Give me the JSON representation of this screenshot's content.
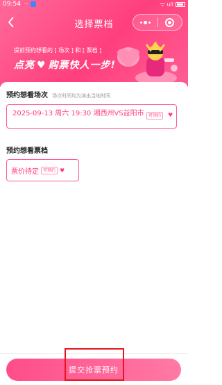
{
  "status_bar": {
    "time": "09:54",
    "small_text": "···",
    "signal_text": "ᯤ ull"
  },
  "nav": {
    "title": "选择票档"
  },
  "banner": {
    "line1": "提前预约想看的 [ 场次 ] 和 [ 票档 ]",
    "line2_left": "点亮",
    "line2_heart": "♥",
    "line2_right": "购票快人一步!"
  },
  "session_section": {
    "title": "预约想看场次",
    "subtitle": "场次时间均为演出当地时间",
    "option_text": "2025-09-13 周六 19:30 湘西州VS益阳市",
    "option_tag": "可预约",
    "option_heart": "♥"
  },
  "price_section": {
    "title": "预约想看票档",
    "option_text": "票价待定",
    "option_tag": "可预约",
    "option_heart": "♥"
  },
  "submit": {
    "label": "提交抢票预约"
  },
  "colors": {
    "brand_pink": "#ff3f7d",
    "highlight_red": "#e5141f"
  }
}
